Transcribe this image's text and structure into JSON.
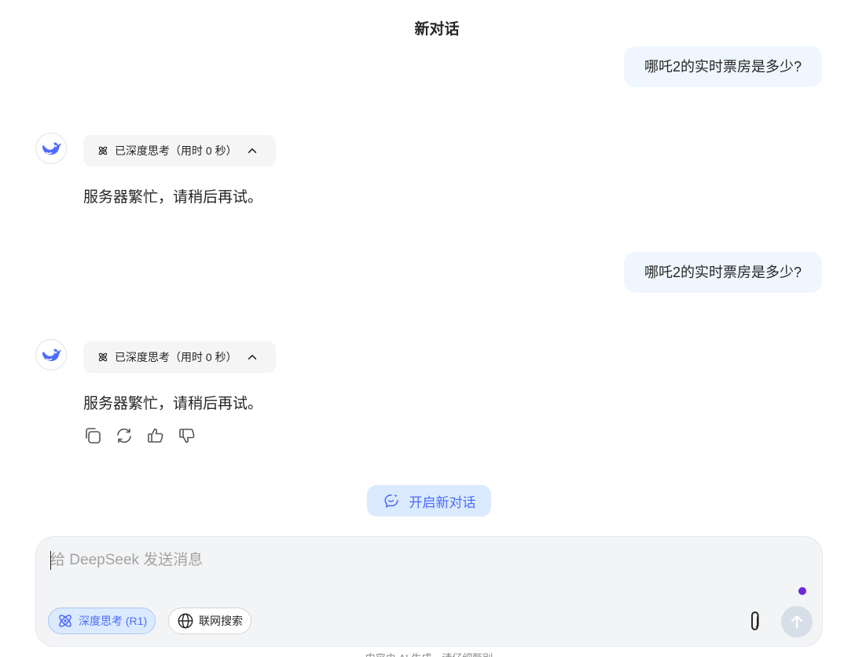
{
  "header": {
    "title": "新对话"
  },
  "messages": [
    {
      "user_text": "哪吒2的实时票房是多少?",
      "think_label": "已深度思考（用时 0 秒）",
      "reply_text": "服务器繁忙，请稍后再试。"
    },
    {
      "user_text": "哪吒2的实时票房是多少?",
      "think_label": "已深度思考（用时 0 秒）",
      "reply_text": "服务器繁忙，请稍后再试。"
    }
  ],
  "actions": {
    "icons": [
      "copy-icon",
      "regenerate-icon",
      "thumbs-up-icon",
      "thumbs-down-icon"
    ]
  },
  "new_chat": {
    "label": "开启新对话"
  },
  "composer": {
    "placeholder": "给 DeepSeek 发送消息",
    "deep_think_label": "深度思考 (R1)",
    "web_search_label": "联网搜索"
  },
  "footer": {
    "text": "内容由 AI 生成，请仔细甄别"
  },
  "colors": {
    "accent": "#4d6bfe",
    "user_bubble": "#eff6ff",
    "pill_bg": "#f5f5f5",
    "composer_bg": "#f3f4f6",
    "send_disabled": "#d6dee8",
    "indicator": "#6d28d9"
  }
}
